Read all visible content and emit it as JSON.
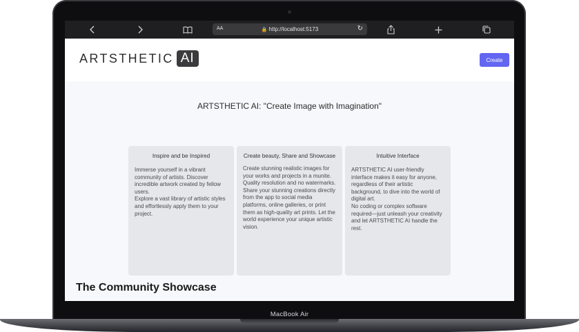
{
  "browser": {
    "url": "http://localhost:5173",
    "reader_label": "AA"
  },
  "site": {
    "logo_text": "ARTSTHETIC",
    "logo_badge": "AI",
    "create_label": "Create",
    "hero_title": "ARTSTHETIC AI: \"Create Image with Imagination\""
  },
  "cards": [
    {
      "title": "Inspire and be Inspired",
      "body": "Immerse yourself in a vibrant community of artists. Discover incredible artwork created by fellow users.\nExplore a vast library of artistic styles and effortlessly apply them to your project."
    },
    {
      "title": "Create beauty, Share and Showcase",
      "body": "Create stunning realistic images for your works and projects in a munite. Quality resolution and no watermarks.\nShare your stunning creations directly from the app to social media platforms, online galleries, or print them as high-quality art prints. Let the world experience your unique artistic vision."
    },
    {
      "title": "Intuitive Interface",
      "body": "ARTSTHETIC AI user-friendly interface makes it easy for anyone, regardless of their artistic background, to dive into the world of digital art.\nNo coding or complex software required—just unleash your creativity and let ARTSTHETIC AI handle the rest."
    }
  ],
  "showcase_title": "The Community Showcase",
  "device_label": "MacBook Air",
  "colors": {
    "accent": "#6366f1",
    "card_bg": "#e5e7eb",
    "page_bg": "#f7f8fb",
    "toolbar_bg": "#1f1f21"
  }
}
